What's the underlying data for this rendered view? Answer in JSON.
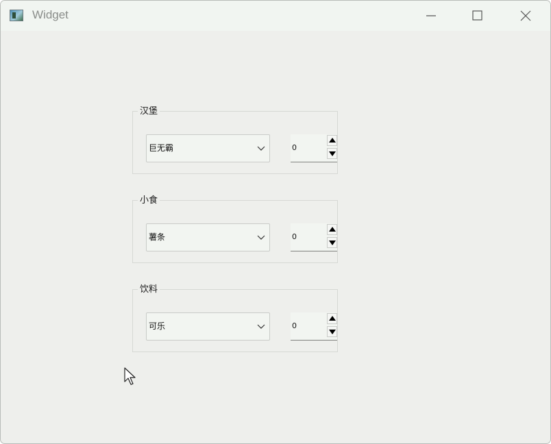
{
  "window": {
    "title": "Widget",
    "icon": "app-window-icon",
    "controls": [
      "minimize-icon",
      "maximize-icon",
      "close-icon"
    ]
  },
  "groups": [
    {
      "title": "汉堡",
      "combo_value": "巨无霸",
      "spin_value": "0"
    },
    {
      "title": "小食",
      "combo_value": "薯条",
      "spin_value": "0"
    },
    {
      "title": "饮料",
      "combo_value": "可乐",
      "spin_value": "0"
    }
  ],
  "colors": {
    "window_bg": "#eeefec",
    "titlebar_bg": "#f1f5f1",
    "title_text": "#8a8d8a",
    "field_bg": "#f2f5f1"
  }
}
